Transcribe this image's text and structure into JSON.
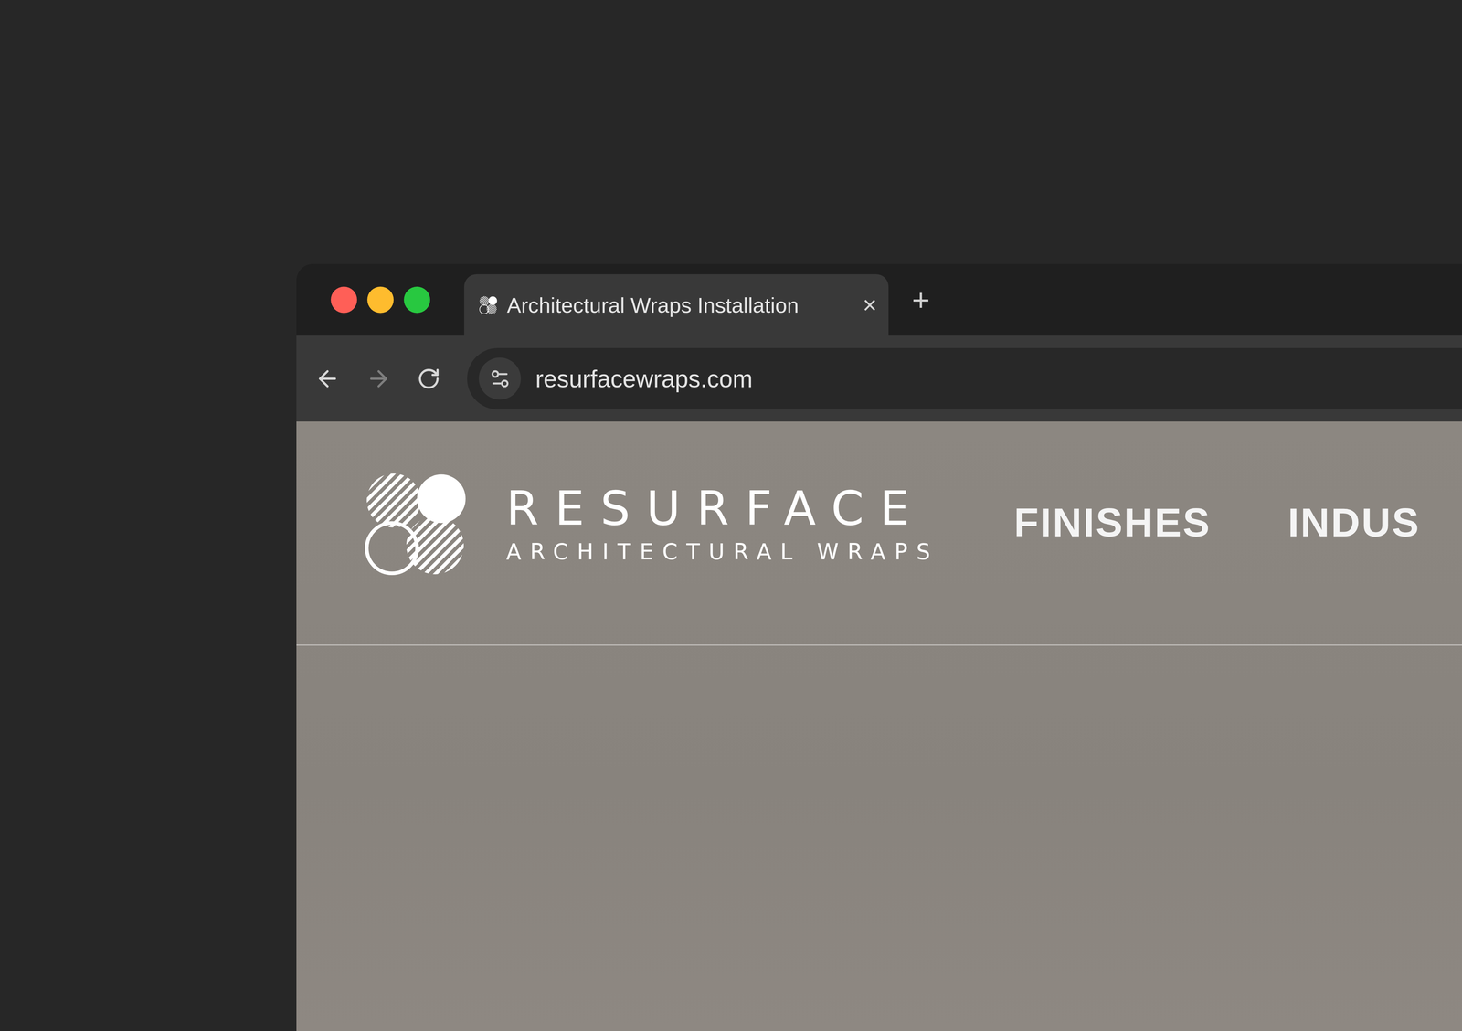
{
  "tabs": [
    {
      "label": "Architectural Wraps Installation",
      "selected": true,
      "close": "×"
    }
  ],
  "new_tab": "+",
  "nav_buttons": [
    {
      "kind": "back",
      "disabled": false
    },
    {
      "kind": "forward",
      "disabled": true
    },
    {
      "kind": "reload",
      "disabled": false
    }
  ],
  "address_bar": {
    "url": "resurfacewraps.com"
  },
  "page": {
    "brand": {
      "name": "RESURFACE",
      "tagline": "ARCHITECTURAL WRAPS"
    },
    "nav": [
      {
        "label": "FINISHES"
      },
      {
        "label": "INDUS"
      }
    ]
  }
}
